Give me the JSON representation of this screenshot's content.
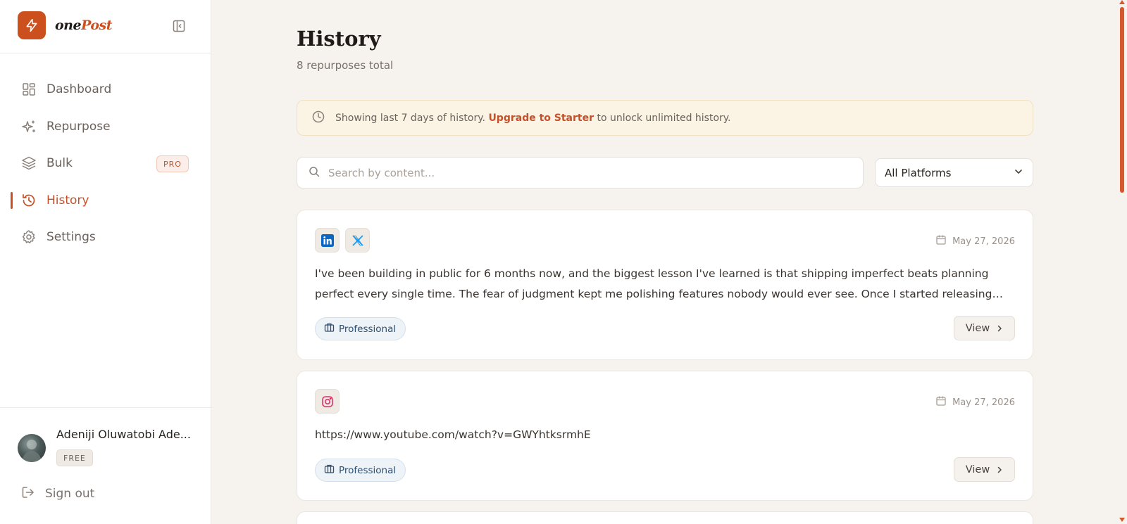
{
  "brand": {
    "name_one": "one",
    "name_post": "Post",
    "accent": "#cc4f1e"
  },
  "sidebar": {
    "items": [
      {
        "label": "Dashboard",
        "icon": "dashboard-grid-icon"
      },
      {
        "label": "Repurpose",
        "icon": "sparkles-icon"
      },
      {
        "label": "Bulk",
        "icon": "layers-icon",
        "badge": "PRO"
      },
      {
        "label": "History",
        "icon": "history-clock-icon",
        "active": true
      },
      {
        "label": "Settings",
        "icon": "gear-icon"
      }
    ],
    "user": {
      "name": "Adeniji Oluwatobi Ade...",
      "plan": "FREE"
    },
    "signout_label": "Sign out"
  },
  "page": {
    "title": "History",
    "subtitle": "8 repurposes total"
  },
  "notice": {
    "text_before": "Showing last 7 days of history. ",
    "link": "Upgrade to Starter",
    "text_after": " to unlock unlimited history."
  },
  "search": {
    "placeholder": "Search by content..."
  },
  "filter": {
    "selected": "All Platforms"
  },
  "cards": [
    {
      "platforms": [
        "linkedin-icon",
        "x-twitter-icon"
      ],
      "date": "May 27, 2026",
      "content": "I've been building in public for 6 months now, and the biggest lesson I've learned is that shipping imperfect beats planning perfect every single time. The fear of judgment kept me polishing features nobody would ever see. Once I started releasing early and often, everything changed.",
      "tone": "Professional",
      "view_label": "View"
    },
    {
      "platforms": [
        "instagram-icon"
      ],
      "date": "May 27, 2026",
      "content": "https://www.youtube.com/watch?v=GWYhtksrmhE",
      "tone": "Professional",
      "view_label": "View"
    }
  ],
  "colors": {
    "accent": "#cc4f1e",
    "background": "#f6f3ee",
    "notice_bg": "#fbf3e3",
    "linkedin": "#0a66c2",
    "x_blue": "#1d9bf0",
    "instagram": "#e1306c"
  }
}
